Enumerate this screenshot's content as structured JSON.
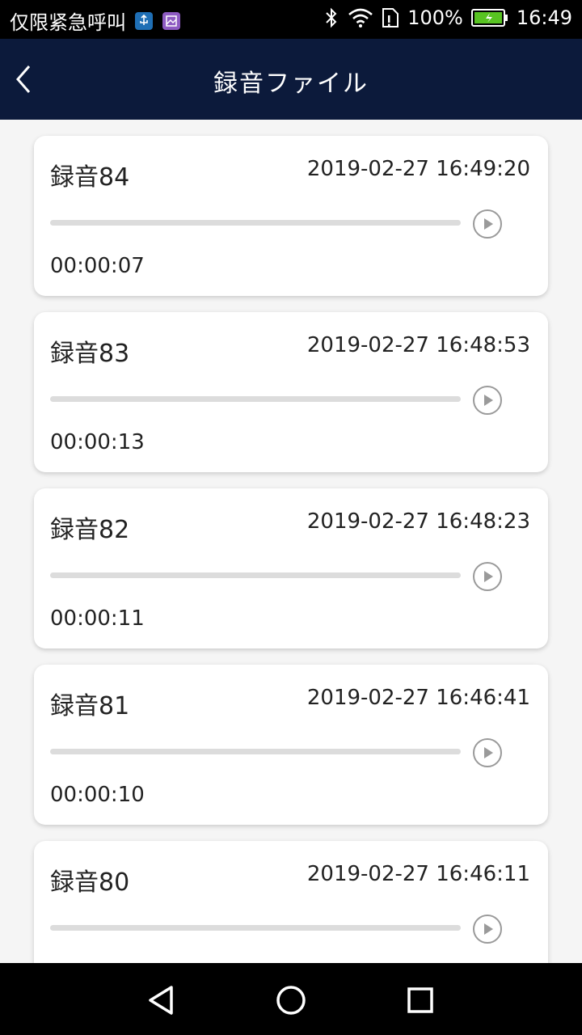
{
  "status_bar": {
    "carrier": "仅限紧急呼叫",
    "battery_percent": "100%",
    "time": "16:49",
    "icons": [
      "usb-icon",
      "image-icon",
      "bluetooth-icon",
      "wifi-icon",
      "sim-icon",
      "battery-icon"
    ]
  },
  "header": {
    "title": "録音ファイル",
    "back_icon": "chevron-left-icon"
  },
  "recordings": [
    {
      "name": "録音84",
      "datetime": "2019-02-27 16:49:20",
      "duration": "00:00:07",
      "progress": 0
    },
    {
      "name": "録音83",
      "datetime": "2019-02-27 16:48:53",
      "duration": "00:00:13",
      "progress": 0
    },
    {
      "name": "録音82",
      "datetime": "2019-02-27 16:48:23",
      "duration": "00:00:11",
      "progress": 0
    },
    {
      "name": "録音81",
      "datetime": "2019-02-27 16:46:41",
      "duration": "00:00:10",
      "progress": 0
    },
    {
      "name": "録音80",
      "datetime": "2019-02-27 16:46:11",
      "duration": "",
      "progress": 0
    }
  ],
  "nav_bar": {
    "icons": [
      "back-triangle-icon",
      "home-circle-icon",
      "recents-square-icon"
    ]
  },
  "colors": {
    "header_bg": "#0c1a3b",
    "card_bg": "#ffffff",
    "page_bg": "#f5f5f5",
    "track": "#dcdcdc",
    "play_icon": "#9a9a9a"
  }
}
